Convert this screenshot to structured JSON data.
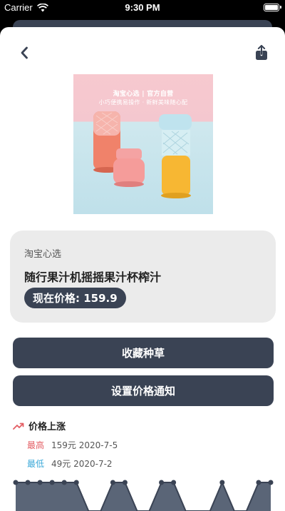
{
  "status_bar": {
    "carrier": "Carrier",
    "time": "9:30 PM"
  },
  "nav": {
    "back_icon": "chevron-left-icon",
    "share_icon": "share-icon"
  },
  "product": {
    "image_caption_line1": "淘宝心选 | 官方自营",
    "image_caption_line2": "小巧便携易操作 · 新鲜美味随心配",
    "brand": "淘宝心选",
    "title": "随行果汁机摇摇果汁杯榨汁",
    "current_price_label": "现在价格: 159.9"
  },
  "actions": {
    "favorite_label": "收藏种草",
    "price_alert_label": "设置价格通知"
  },
  "price_trend": {
    "title": "价格上涨",
    "high": {
      "label": "最高",
      "value": "159元 2020-7-5"
    },
    "low": {
      "label": "最低",
      "value": "49元 2020-7-2"
    }
  },
  "chart_data": {
    "type": "area",
    "x": [
      0,
      1,
      2,
      3,
      4,
      5,
      6,
      7,
      8,
      9,
      10,
      11,
      12,
      13,
      14,
      15,
      16,
      17,
      18,
      19,
      20,
      21
    ],
    "values": [
      159,
      159,
      159,
      159,
      159,
      159,
      49,
      49,
      159,
      159,
      49,
      49,
      159,
      159,
      49,
      49,
      49,
      159,
      49,
      49,
      159,
      159
    ],
    "color": "#5a6577"
  },
  "colors": {
    "accent": "#3a4354",
    "high": "#e35d63",
    "low": "#3aa8d8",
    "trend_icon": "#e35d63"
  }
}
